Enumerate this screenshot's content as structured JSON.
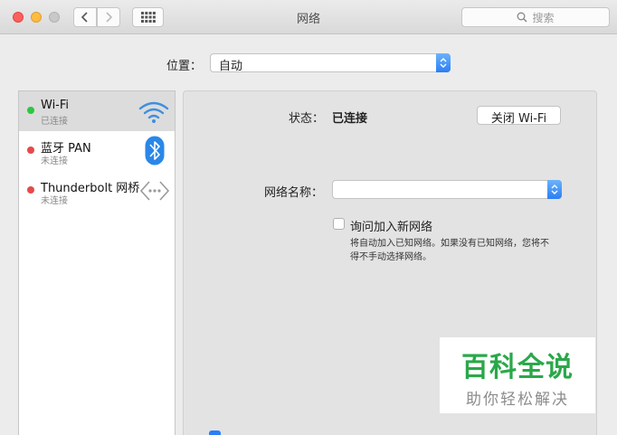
{
  "window": {
    "title": "网络"
  },
  "toolbar": {
    "search_placeholder": "搜索"
  },
  "location": {
    "label": "位置：",
    "value": "自动"
  },
  "services": [
    {
      "name": "Wi-Fi",
      "status": "已连接",
      "status_color": "#2fc641",
      "icon": "wifi-icon"
    },
    {
      "name": "蓝牙 PAN",
      "status": "未连接",
      "status_color": "#e64949",
      "icon": "bluetooth-icon"
    },
    {
      "name": "Thunderbolt 网桥",
      "status": "未连接",
      "status_color": "#e64949",
      "icon": "thunderbolt-bridge-icon"
    }
  ],
  "detail": {
    "status_label": "状态：",
    "status_value": "已连接",
    "toggle_wifi_button": "关闭 Wi-Fi",
    "network_name_label": "网络名称：",
    "network_name_value": "",
    "ask_join_label": "询问加入新网络",
    "ask_join_note_line1": "将自动加入已知网络。如果没有已知网络，您将不",
    "ask_join_note_line2": "得不手动选择网络。"
  },
  "watermark": {
    "title": "百科全说",
    "subtitle": "助你轻松解决"
  },
  "colors": {
    "accent": "#2a7ef6",
    "watermark_green": "#2aa84a"
  }
}
